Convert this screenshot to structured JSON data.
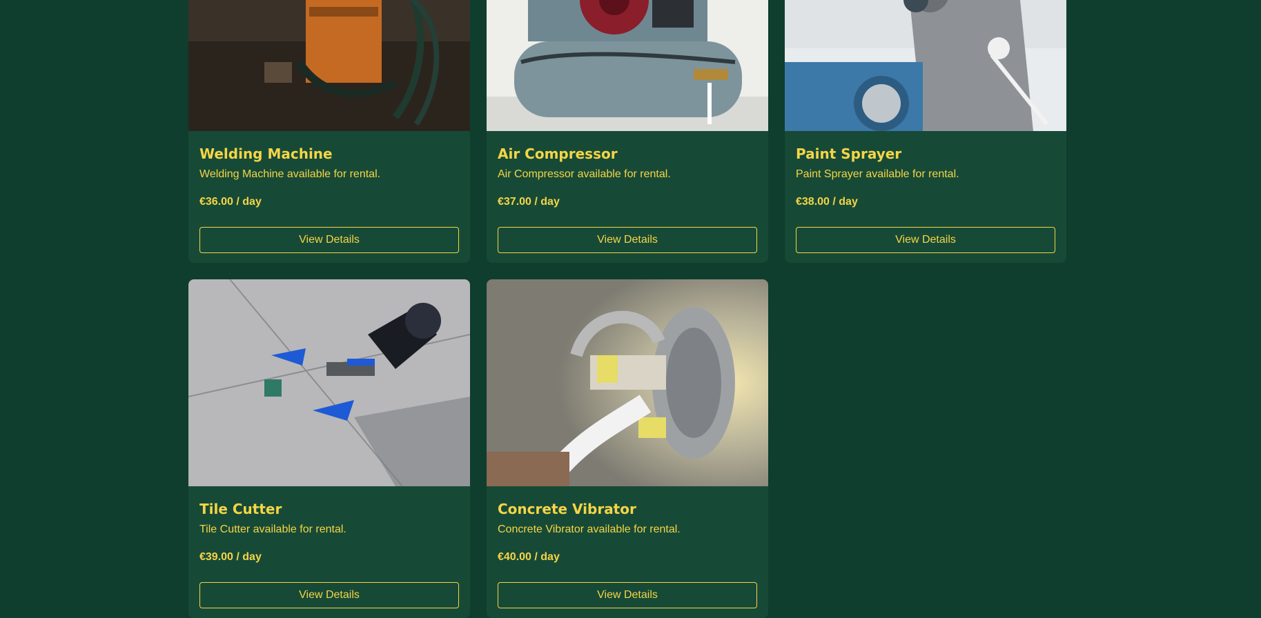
{
  "products": [
    {
      "title": "Welding Machine",
      "description": "Welding Machine available for rental.",
      "price": "€36.00 / day",
      "button": "View Details",
      "image": "welding-machine-photo"
    },
    {
      "title": "Air Compressor",
      "description": "Air Compressor available for rental.",
      "price": "€37.00 / day",
      "button": "View Details",
      "image": "air-compressor-photo"
    },
    {
      "title": "Paint Sprayer",
      "description": "Paint Sprayer available for rental.",
      "price": "€38.00 / day",
      "button": "View Details",
      "image": "paint-sprayer-photo"
    },
    {
      "title": "Tile Cutter",
      "description": "Tile Cutter available for rental.",
      "price": "€39.00 / day",
      "button": "View Details",
      "image": "tile-cutter-photo"
    },
    {
      "title": "Concrete Vibrator",
      "description": "Concrete Vibrator available for rental.",
      "price": "€40.00 / day",
      "button": "View Details",
      "image": "concrete-vibrator-photo"
    }
  ],
  "colors": {
    "page_background": "#0f3d2e",
    "card_background": "#174a36",
    "accent": "#f5d547"
  }
}
